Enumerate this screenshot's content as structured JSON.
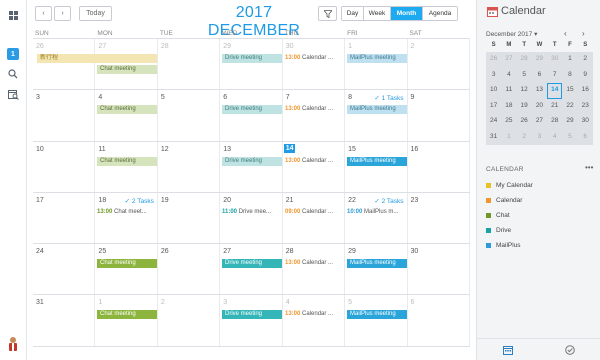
{
  "header": {
    "today_label": "Today",
    "month_title": "2017 DECEMBER",
    "views": [
      {
        "label": "Day",
        "active": false
      },
      {
        "label": "Week",
        "active": false
      },
      {
        "label": "Month",
        "active": true
      },
      {
        "label": "Agenda",
        "active": false
      }
    ]
  },
  "rail": {
    "badge": "1"
  },
  "weekdays": [
    "SUN",
    "MON",
    "TUE",
    "WED",
    "THU",
    "FRI",
    "SAT"
  ],
  "weeks": [
    {
      "days": [
        "26",
        "27",
        "28",
        "29",
        "30",
        "1",
        "2"
      ]
    },
    {
      "days": [
        "3",
        "4",
        "5",
        "6",
        "7",
        "8",
        "9"
      ],
      "tasks_label": "1 Tasks"
    },
    {
      "days": [
        "10",
        "11",
        "12",
        "13",
        "14",
        "15",
        "16"
      ]
    },
    {
      "days": [
        "17",
        "18",
        "19",
        "20",
        "21",
        "22",
        "23"
      ],
      "tasks_mon": "2 Tasks",
      "tasks_fri": "2 Tasks"
    },
    {
      "days": [
        "24",
        "25",
        "26",
        "27",
        "28",
        "29",
        "30"
      ]
    },
    {
      "days": [
        "31",
        "1",
        "2",
        "3",
        "4",
        "5",
        "6"
      ]
    }
  ],
  "events": {
    "special": "新行程",
    "chat": "Chat meeting",
    "drive": "Drive meeting",
    "mailplus": "MailPlus meeting",
    "cal_short": "Calendar ...",
    "chat_meet_short": "Chat meet...",
    "drive_mee_short": "Drive mee...",
    "mailplus_short": "MailPlus m...",
    "time_1300": "13:00",
    "time_1100": "11:00",
    "time_0900": "09:00",
    "time_1000": "10:00"
  },
  "panel": {
    "title": "Calendar",
    "mini_month": "December 2017",
    "mini_dow": [
      "S",
      "M",
      "T",
      "W",
      "T",
      "F",
      "S"
    ],
    "mini_weeks": [
      [
        "26",
        "27",
        "28",
        "29",
        "30",
        "1",
        "2"
      ],
      [
        "3",
        "4",
        "5",
        "6",
        "7",
        "8",
        "9"
      ],
      [
        "10",
        "11",
        "12",
        "13",
        "14",
        "15",
        "16"
      ],
      [
        "17",
        "18",
        "19",
        "20",
        "21",
        "22",
        "23"
      ],
      [
        "24",
        "25",
        "26",
        "27",
        "28",
        "29",
        "30"
      ],
      [
        "31",
        "1",
        "2",
        "3",
        "4",
        "5",
        "6"
      ]
    ],
    "section_label": "CALENDAR",
    "calendars": [
      {
        "name": "My Calendar",
        "color": "#e6c229"
      },
      {
        "name": "Calendar",
        "color": "#f0962d"
      },
      {
        "name": "Chat",
        "color": "#6f9727"
      },
      {
        "name": "Drive",
        "color": "#1aa1a4"
      },
      {
        "name": "MailPlus",
        "color": "#2f9ad8"
      }
    ]
  },
  "colors": {
    "accent": "#1e9ae6",
    "chat": "#8db43d",
    "drive": "#34b5b8",
    "mailplus": "#2aa5d9"
  }
}
